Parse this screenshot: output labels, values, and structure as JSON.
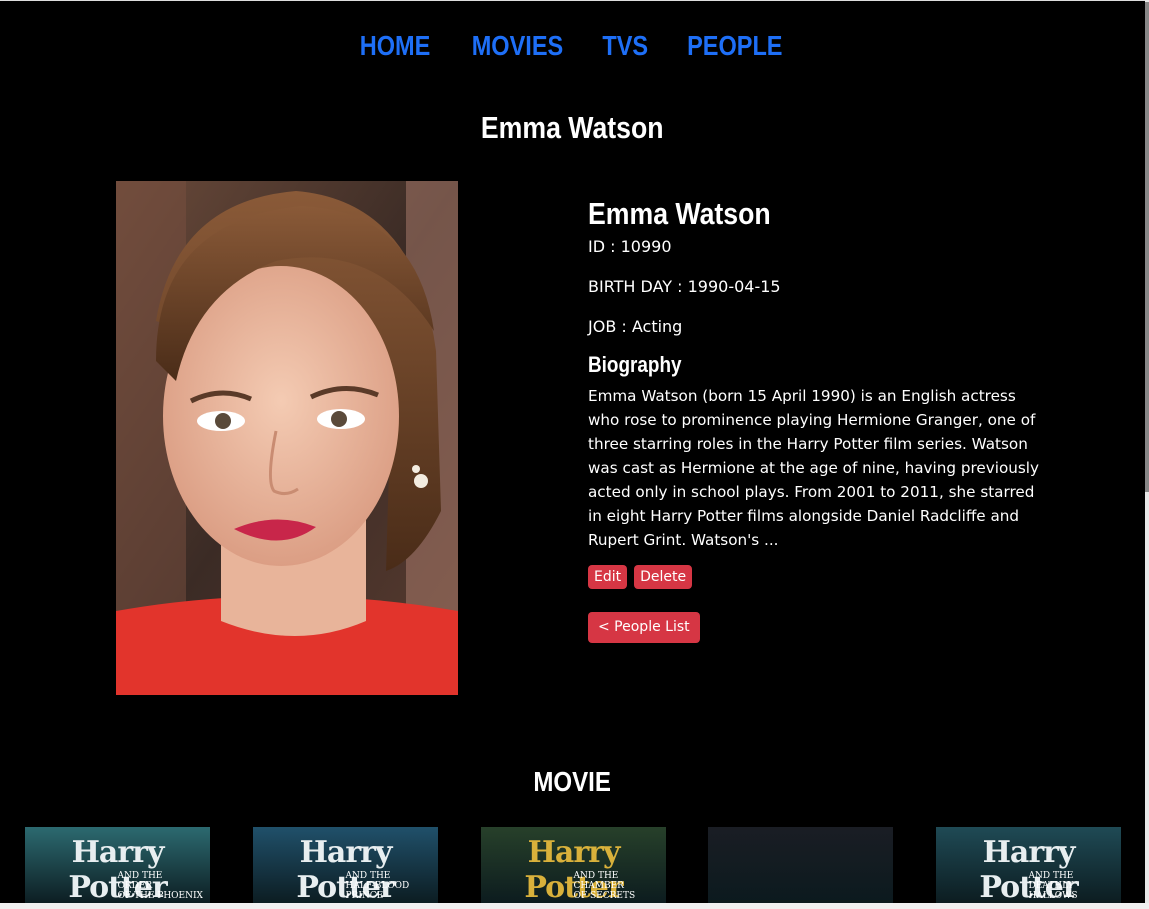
{
  "nav": {
    "items": [
      "HOME",
      "MOVIES",
      "TVS",
      "PEOPLE"
    ]
  },
  "page_title": "Emma Watson",
  "person": {
    "name": "Emma Watson",
    "id_label": "ID : 10990",
    "birthday_label": "BIRTH DAY : 1990-04-15",
    "job_label": "JOB : Acting",
    "biography_heading": "Biography",
    "biography": "Emma Watson (born 15 April 1990) is an English actress who rose to prominence playing Hermione Granger, one of three starring roles in the Harry Potter film series. Watson was cast as Hermione at the age of nine, having previously acted only in school plays. From 2001 to 2011, she starred in eight Harry Potter films alongside Daniel Radcliffe and Rupert Grint. Watson's ..."
  },
  "actions": {
    "edit_label": "Edit",
    "delete_label": "Delete",
    "back_label": "< People List"
  },
  "movies_heading": "MOVIE",
  "movies": [
    {
      "title": "Harry Potter",
      "subtitle": "AND THE\nORDER\nOF THE PHOENIX",
      "color": "#e8eef0",
      "bg": "#2c6a70"
    },
    {
      "title": "Harry Potter",
      "subtitle": "AND THE\nHALF-BLOOD\nPRINCE",
      "color": "#e8eef0",
      "bg": "#20506a"
    },
    {
      "title": "Harry Potter",
      "subtitle": "AND THE\nCHAMBER\nOF SECRETS",
      "color": "#d9b13b",
      "bg": "#27402a"
    },
    {
      "title": "",
      "subtitle": "",
      "color": "#ffffff",
      "bg": "#1a1d24"
    },
    {
      "title": "Harry Potter",
      "subtitle": "AND THE\nDEATHLY\nHALLOWS",
      "color": "#e8eef0",
      "bg": "#1f4a55"
    }
  ],
  "colors": {
    "nav_link": "#1e6ff7",
    "button": "#d63644",
    "background": "#000000"
  }
}
